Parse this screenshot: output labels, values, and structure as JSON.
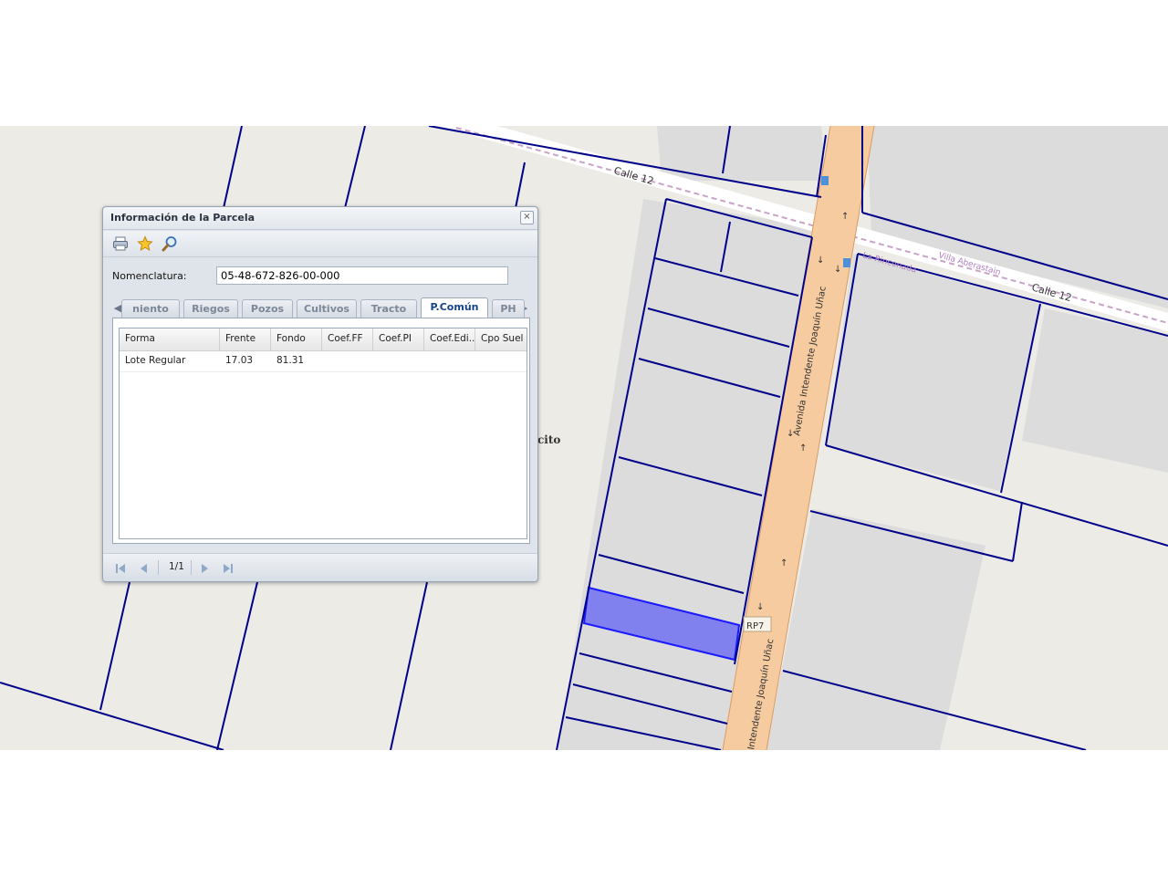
{
  "window": {
    "title": "Información de la Parcela",
    "close_label": "×"
  },
  "toolbar": {
    "items": [
      {
        "name": "print-icon"
      },
      {
        "name": "star-icon"
      },
      {
        "name": "magnifier-icon"
      }
    ]
  },
  "nomenclatura": {
    "label": "Nomenclatura:",
    "value": "05-48-672-826-00-000"
  },
  "tabs": {
    "items": [
      {
        "label": "niento",
        "active": false
      },
      {
        "label": "Riegos",
        "active": false
      },
      {
        "label": "Pozos",
        "active": false
      },
      {
        "label": "Cultivos",
        "active": false
      },
      {
        "label": "Tracto",
        "active": false
      },
      {
        "label": "P.Común",
        "active": true
      },
      {
        "label": "PH",
        "active": false
      }
    ],
    "scroll_left_icon": "arrow-left-icon",
    "scroll_right_icon": "arrow-right-icon"
  },
  "grid": {
    "columns": [
      "Forma",
      "Frente",
      "Fondo",
      "Coef.FF",
      "Coef.PI",
      "Coef.Edi..",
      "Cpo Suel"
    ],
    "rows": [
      [
        "Lote Regular",
        "17.03",
        "81.31",
        "",
        "",
        "",
        ""
      ]
    ]
  },
  "pager": {
    "text": "1/1"
  },
  "map": {
    "labels": {
      "calle_12_a": "Calle 12",
      "calle_12_b": "Calle 12",
      "avenida": "Avenida Intendente Joaquín Uñac",
      "avenida_b": "Intendente Joaquín Uñac",
      "villa": "Villa Aberastain",
      "la_rinconada": "La Rinconada",
      "rp7": "RP7",
      "partial": "cito"
    },
    "colors": {
      "parcel_line": "#00008b",
      "selected_fill": "#8080ee",
      "road": "#f6cba0",
      "block": "#dcdcdc",
      "background": "#ecebe6"
    }
  }
}
